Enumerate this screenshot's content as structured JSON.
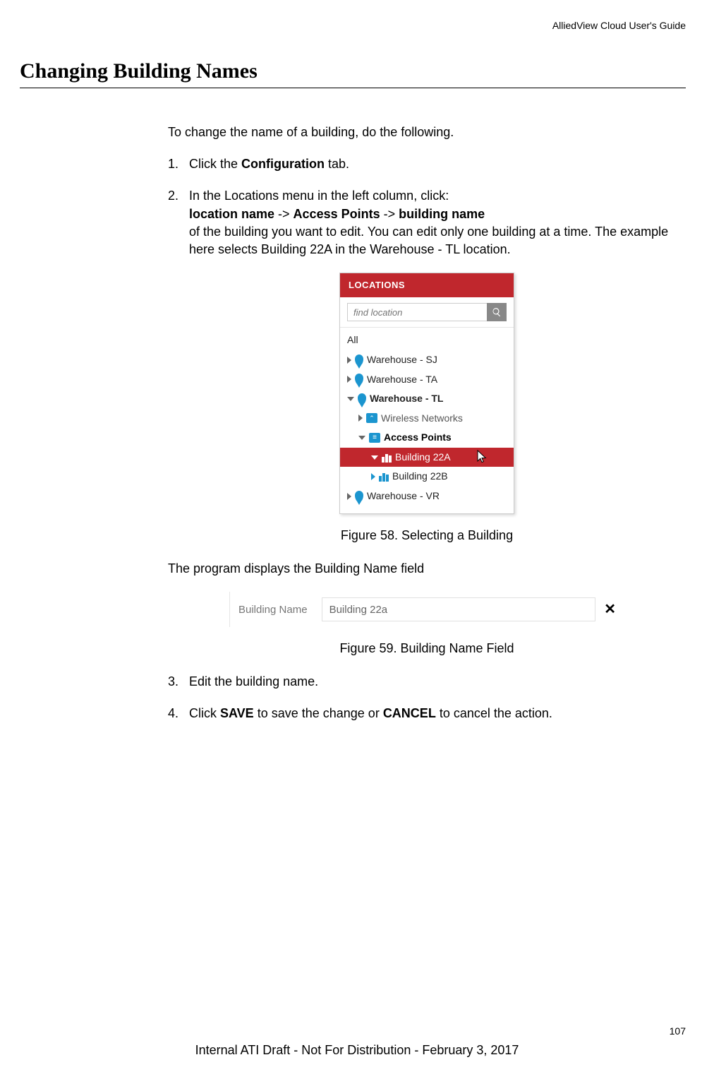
{
  "header": {
    "guide": "AlliedView Cloud User's Guide"
  },
  "title": "Changing Building Names",
  "intro": "To change the name of a building, do the following.",
  "steps": {
    "s1": {
      "num": "1.",
      "pre": "Click the ",
      "bold": "Configuration",
      "post": " tab."
    },
    "s2": {
      "num": "2.",
      "line1": "In the Locations menu in the left column, click:",
      "b1": "location name",
      "a1": " -> ",
      "b2": "Access Points",
      "a2": " -> ",
      "b3": "building name",
      "rest": "of the building you want to edit. You can edit only one building at a time. The example here selects Building 22A in the Warehouse - TL location."
    },
    "s3": {
      "num": "3.",
      "text": "Edit the building name."
    },
    "s4": {
      "num": "4.",
      "pre": "Click ",
      "b1": "SAVE",
      "mid": " to save the change or ",
      "b2": "CANCEL",
      "post": " to cancel the action."
    }
  },
  "panel": {
    "header": "LOCATIONS",
    "search_placeholder": "find location",
    "all": "All",
    "items": {
      "sj": "Warehouse - SJ",
      "ta": "Warehouse - TA",
      "tl": "Warehouse - TL",
      "wireless": "Wireless Networks",
      "aps": "Access Points",
      "b22a": "Building 22A",
      "b22b": "Building 22B",
      "vr": "Warehouse - VR"
    }
  },
  "caption1": "Figure 58. Selecting a Building",
  "after_fig1": "The program displays the Building Name field",
  "field": {
    "label": "Building Name",
    "value": "Building 22a",
    "clear": "✕"
  },
  "caption2": "Figure 59. Building Name Field",
  "page_number": "107",
  "footer": "Internal ATI Draft - Not For Distribution - February 3, 2017"
}
